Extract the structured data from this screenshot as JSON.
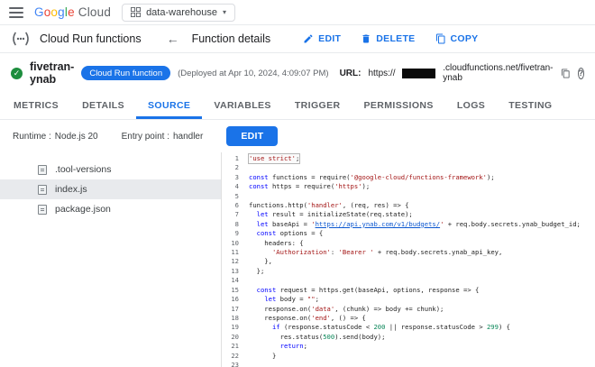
{
  "topbar": {
    "logo_letters": [
      {
        "ch": "G",
        "color": "#4285F4"
      },
      {
        "ch": "o",
        "color": "#EA4335"
      },
      {
        "ch": "o",
        "color": "#FBBC05"
      },
      {
        "ch": "g",
        "color": "#4285F4"
      },
      {
        "ch": "l",
        "color": "#34A853"
      },
      {
        "ch": "e",
        "color": "#EA4335"
      }
    ],
    "logo_cloud": "Cloud",
    "project": "data-warehouse"
  },
  "icons": {
    "back": "←",
    "caret": "▾",
    "help": "?",
    "check": "✓"
  },
  "header": {
    "product": "Cloud Run functions",
    "page_title": "Function details",
    "actions": {
      "edit": "EDIT",
      "delete": "DELETE",
      "copy": "COPY"
    }
  },
  "function_header": {
    "name": "fivetran-ynab",
    "badge": "Cloud Run function",
    "deployed": "(Deployed at Apr 10, 2024, 4:09:07 PM)",
    "url_label": "URL:",
    "url_prefix": "https://",
    "url_suffix": ".cloudfunctions.net/fivetran-ynab"
  },
  "tabs": [
    {
      "label": "METRICS",
      "active": false
    },
    {
      "label": "DETAILS",
      "active": false
    },
    {
      "label": "SOURCE",
      "active": true
    },
    {
      "label": "VARIABLES",
      "active": false
    },
    {
      "label": "TRIGGER",
      "active": false
    },
    {
      "label": "PERMISSIONS",
      "active": false
    },
    {
      "label": "LOGS",
      "active": false
    },
    {
      "label": "TESTING",
      "active": false
    }
  ],
  "source_toolbar": {
    "runtime_label": "Runtime :",
    "runtime_value": "Node.js 20",
    "entry_label": "Entry point :",
    "entry_value": "handler",
    "edit_button": "EDIT"
  },
  "files": [
    {
      "name": ".tool-versions",
      "selected": false
    },
    {
      "name": "index.js",
      "selected": true
    },
    {
      "name": "package.json",
      "selected": false
    }
  ],
  "colors": {
    "accent": "#1a73e8",
    "status_ok": "#1e8e3e",
    "keyword": "#0000ff",
    "string": "#a31515",
    "number": "#098658"
  },
  "code": {
    "lines": [
      {
        "no": 1,
        "boxed": true,
        "segs": [
          [
            "s",
            "'use strict'"
          ],
          [
            "p",
            ";"
          ]
        ]
      },
      {
        "no": 2,
        "segs": []
      },
      {
        "no": 3,
        "segs": [
          [
            "k",
            "const"
          ],
          [
            "p",
            " functions = require("
          ],
          [
            "s",
            "'@google-cloud/functions-framework'"
          ],
          [
            "p",
            ");"
          ]
        ]
      },
      {
        "no": 4,
        "segs": [
          [
            "k",
            "const"
          ],
          [
            "p",
            " https = require("
          ],
          [
            "s",
            "'https'"
          ],
          [
            "p",
            ");"
          ]
        ]
      },
      {
        "no": 5,
        "segs": []
      },
      {
        "no": 6,
        "segs": [
          [
            "p",
            "functions.http("
          ],
          [
            "s",
            "'handler'"
          ],
          [
            "p",
            ", (req, res) => {"
          ]
        ]
      },
      {
        "no": 7,
        "segs": [
          [
            "p",
            "  "
          ],
          [
            "k",
            "let"
          ],
          [
            "p",
            " result = initializeState(req.state);"
          ]
        ]
      },
      {
        "no": 8,
        "segs": [
          [
            "p",
            "  "
          ],
          [
            "k",
            "let"
          ],
          [
            "p",
            " baseApi = "
          ],
          [
            "s",
            "'"
          ],
          [
            "l",
            "https://api.ynab.com/v1/budgets/"
          ],
          [
            "s",
            "'"
          ],
          [
            "p",
            " + req.body.secrets.ynab_budget_id;"
          ]
        ]
      },
      {
        "no": 9,
        "segs": [
          [
            "p",
            "  "
          ],
          [
            "k",
            "const"
          ],
          [
            "p",
            " options = {"
          ]
        ]
      },
      {
        "no": 10,
        "segs": [
          [
            "p",
            "    headers: {"
          ]
        ]
      },
      {
        "no": 11,
        "segs": [
          [
            "p",
            "      "
          ],
          [
            "s",
            "'Authorization'"
          ],
          [
            "p",
            ": "
          ],
          [
            "s",
            "'Bearer '"
          ],
          [
            "p",
            " + req.body.secrets.ynab_api_key,"
          ]
        ]
      },
      {
        "no": 12,
        "segs": [
          [
            "p",
            "    },"
          ]
        ]
      },
      {
        "no": 13,
        "segs": [
          [
            "p",
            "  };"
          ]
        ]
      },
      {
        "no": 14,
        "segs": []
      },
      {
        "no": 15,
        "segs": [
          [
            "p",
            "  "
          ],
          [
            "k",
            "const"
          ],
          [
            "p",
            " request = https.get(baseApi, options, response => {"
          ]
        ]
      },
      {
        "no": 16,
        "segs": [
          [
            "p",
            "    "
          ],
          [
            "k",
            "let"
          ],
          [
            "p",
            " body = "
          ],
          [
            "s",
            "\"\""
          ],
          [
            "p",
            ";"
          ]
        ]
      },
      {
        "no": 17,
        "segs": [
          [
            "p",
            "    response.on("
          ],
          [
            "s",
            "'data'"
          ],
          [
            "p",
            ", (chunk) => body += chunk);"
          ]
        ]
      },
      {
        "no": 18,
        "segs": [
          [
            "p",
            "    response.on("
          ],
          [
            "s",
            "'end'"
          ],
          [
            "p",
            ", () => {"
          ]
        ]
      },
      {
        "no": 19,
        "segs": [
          [
            "p",
            "      "
          ],
          [
            "k",
            "if"
          ],
          [
            "p",
            " (response.statusCode < "
          ],
          [
            "n",
            "200"
          ],
          [
            "p",
            " || response.statusCode > "
          ],
          [
            "n",
            "299"
          ],
          [
            "p",
            ") {"
          ]
        ]
      },
      {
        "no": 20,
        "segs": [
          [
            "p",
            "        res.status("
          ],
          [
            "n",
            "500"
          ],
          [
            "p",
            ").send(body);"
          ]
        ]
      },
      {
        "no": 21,
        "segs": [
          [
            "p",
            "        "
          ],
          [
            "k",
            "return"
          ],
          [
            "p",
            ";"
          ]
        ]
      },
      {
        "no": 22,
        "segs": [
          [
            "p",
            "      }"
          ]
        ]
      },
      {
        "no": 23,
        "segs": []
      }
    ]
  }
}
